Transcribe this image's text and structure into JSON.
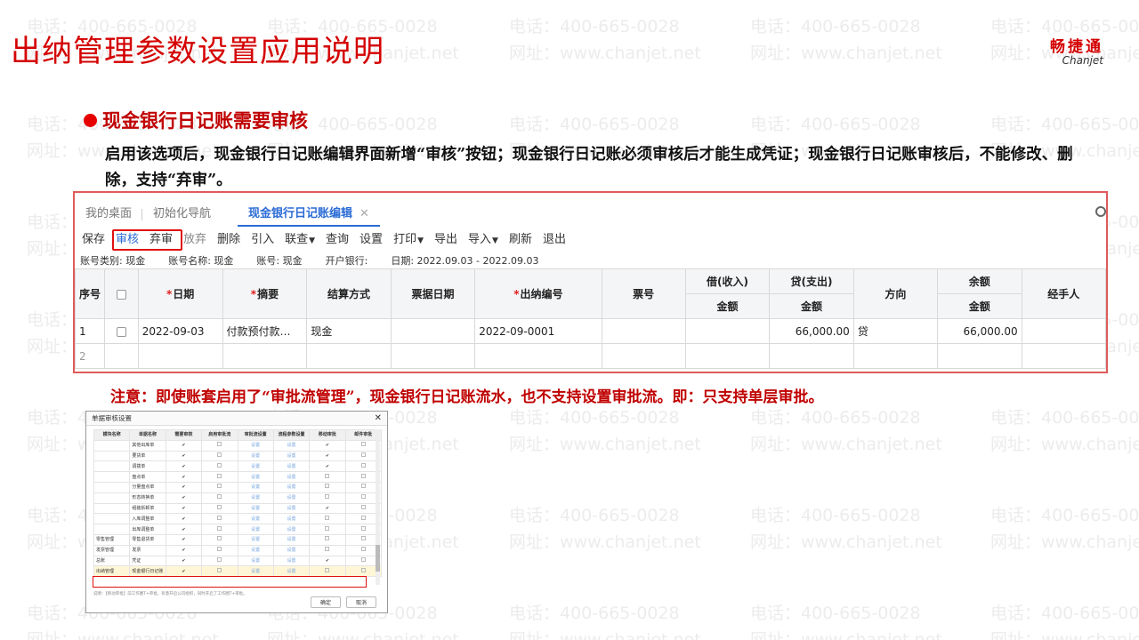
{
  "slide": {
    "title": "出纳管理参数设置应用说明",
    "logo_cn": "畅捷通",
    "logo_en": "Chanjet",
    "watermark_phone": "电话：400-665-0028",
    "watermark_url": "网址：www.chanjet.net"
  },
  "section": {
    "heading": "现金银行日记账需要审核",
    "description": "启用该选项后，现金银行日记账编辑界面新增“审核”按钮；现金银行日记账必须审核后才能生成凭证；现金银行日记账审核后，不能修改、删除，支持“弃审”。",
    "note": "注意：即使账套启用了“审批流管理”，现金银行日记账流水，也不支持设置审批流。即：只支持单层审批。"
  },
  "app": {
    "tabs": [
      {
        "label": "我的桌面"
      },
      {
        "label": "初始化导航"
      },
      {
        "label": "现金银行日记账编辑",
        "active": true
      }
    ],
    "tab_close": "✕",
    "toolbar": [
      {
        "label": "保存"
      },
      {
        "label": "审核",
        "color": "blue"
      },
      {
        "label": "弃审"
      },
      {
        "label": "放弃",
        "color": "gray"
      },
      {
        "label": "删除"
      },
      {
        "label": "引入"
      },
      {
        "label": "联查",
        "dropdown": true
      },
      {
        "label": "查询"
      },
      {
        "label": "设置"
      },
      {
        "label": "打印",
        "dropdown": true
      },
      {
        "label": "导出"
      },
      {
        "label": "导入",
        "dropdown": true
      },
      {
        "label": "刷新"
      },
      {
        "label": "退出"
      }
    ],
    "info": {
      "account_type": "账号类别: 现金",
      "account_name": "账号名称: 现金",
      "account_no": "账号: 现金",
      "bank": "开户银行:",
      "date": "日期: 2022.09.03 - 2022.09.03"
    },
    "columns": {
      "seq": "序号",
      "date": "日期",
      "summary": "摘要",
      "settle": "结算方式",
      "bill_date": "票据日期",
      "cashier_no": "出纳编号",
      "bill_no": "票号",
      "debit": "借(收入)",
      "credit": "贷(支出)",
      "direction": "方向",
      "balance": "余额",
      "handler": "经手人",
      "amount": "金额"
    },
    "rows": [
      {
        "seq": "1",
        "date": "2022-09-03",
        "summary": "付款预付款…",
        "settle": "现金",
        "bill_date": "",
        "cashier_no": "2022-09-0001",
        "bill_no": "",
        "debit": "",
        "credit": "66,000.00",
        "direction": "贷",
        "balance": "66,000.00",
        "handler": ""
      },
      {
        "seq": "2",
        "date": "",
        "summary": "",
        "settle": "",
        "bill_date": "",
        "cashier_no": "",
        "bill_no": "",
        "debit": "",
        "credit": "",
        "direction": "",
        "balance": "",
        "handler": ""
      }
    ]
  },
  "dialog": {
    "title": "单据审核设置",
    "close": "✕",
    "columns": [
      "模块名称",
      "单据名称",
      "需要审核",
      "启用审批流",
      "审批流设置",
      "流程参数设置",
      "移动审批",
      "邮件审批"
    ],
    "rows": [
      {
        "module": "",
        "name": "其他出库单",
        "need": "✔",
        "flow": "",
        "flow_set": "设置",
        "param": "设置",
        "mobile": "✔",
        "mail": ""
      },
      {
        "module": "",
        "name": "要货单",
        "need": "✔",
        "flow": "",
        "flow_set": "设置",
        "param": "设置",
        "mobile": "✔",
        "mail": ""
      },
      {
        "module": "",
        "name": "调拨单",
        "need": "✔",
        "flow": "",
        "flow_set": "设置",
        "param": "设置",
        "mobile": "✔",
        "mail": ""
      },
      {
        "module": "",
        "name": "盘点单",
        "need": "✔",
        "flow": "",
        "flow_set": "设置",
        "param": "设置",
        "mobile": "",
        "mail": ""
      },
      {
        "module": "",
        "name": "分量盘点单",
        "need": "✔",
        "flow": "",
        "flow_set": "设置",
        "param": "设置",
        "mobile": "",
        "mail": ""
      },
      {
        "module": "",
        "name": "形态转换单",
        "need": "✔",
        "flow": "",
        "flow_set": "设置",
        "param": "设置",
        "mobile": "",
        "mail": ""
      },
      {
        "module": "",
        "name": "组装拆卸单",
        "need": "✔",
        "flow": "",
        "flow_set": "设置",
        "param": "设置",
        "mobile": "✔",
        "mail": ""
      },
      {
        "module": "",
        "name": "入库调整单",
        "need": "✔",
        "flow": "",
        "flow_set": "设置",
        "param": "设置",
        "mobile": "",
        "mail": ""
      },
      {
        "module": "",
        "name": "出库调整单",
        "need": "✔",
        "flow": "",
        "flow_set": "设置",
        "param": "设置",
        "mobile": "",
        "mail": ""
      },
      {
        "module": "零售管理",
        "name": "零售退货单",
        "need": "✔",
        "flow": "",
        "flow_set": "设置",
        "param": "设置",
        "mobile": "",
        "mail": ""
      },
      {
        "module": "发票管理",
        "name": "发票",
        "need": "✔",
        "flow": "",
        "flow_set": "设置",
        "param": "设置",
        "mobile": "",
        "mail": ""
      },
      {
        "module": "总账",
        "name": "凭证",
        "need": "✔",
        "flow": "",
        "flow_set": "设置",
        "param": "设置",
        "mobile": "✔",
        "mail": ""
      },
      {
        "module": "出纳管理",
        "name": "现金银行日记账",
        "need": "✔",
        "flow": "",
        "flow_set": "设置",
        "param": "设置",
        "mobile": "",
        "mail": "",
        "highlight": true
      }
    ],
    "footnote": "说明：【移动审批】前工作圈T+审批，有意开启公司组织，同时开启了工作圈T+审批。",
    "ok": "确定",
    "cancel": "取消"
  }
}
